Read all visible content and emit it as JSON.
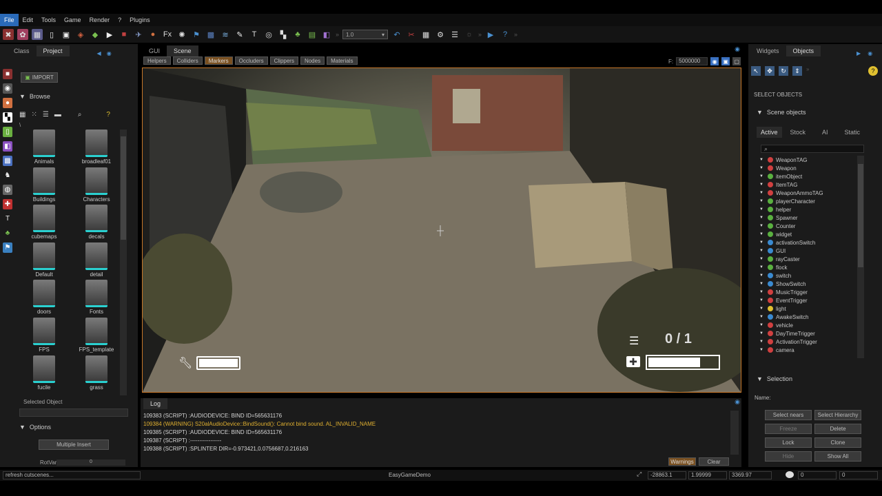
{
  "menu": [
    "File",
    "Edit",
    "Tools",
    "Game",
    "Render",
    "?",
    "Plugins"
  ],
  "toolbar": {
    "combo_value": "1.0"
  },
  "left_panel": {
    "tabs": [
      "Class",
      "Project"
    ],
    "import_label": "IMPORT",
    "browse_label": "Browse",
    "path": "\\",
    "folders": [
      {
        "name": "Animals"
      },
      {
        "name": "broadleaf01"
      },
      {
        "name": "Buildings"
      },
      {
        "name": "Characters"
      },
      {
        "name": "cubemaps"
      },
      {
        "name": "decals"
      },
      {
        "name": "Default"
      },
      {
        "name": "detail"
      },
      {
        "name": "doors"
      },
      {
        "name": "Fonts"
      },
      {
        "name": "FPS"
      },
      {
        "name": "FPS_template"
      },
      {
        "name": "fucile"
      },
      {
        "name": "grass"
      }
    ],
    "selected_object_label": "Selected Object",
    "options_label": "Options",
    "multiple_insert_label": "Multiple Insert",
    "rotvar_label": "RotVar",
    "rotvar_value": "0"
  },
  "center": {
    "tabs": [
      "GUI",
      "Scene"
    ],
    "filters": [
      "Helpers",
      "Colliders",
      "Markers",
      "Occluders",
      "Clippers",
      "Nodes",
      "Materials"
    ],
    "far_label": "F:",
    "far_value": "5000000",
    "hud": {
      "ammo": "0 / 1",
      "health_fill": 0.75,
      "tool_fill": 1.0
    }
  },
  "log": {
    "tab": "Log",
    "lines": [
      {
        "text": "109383 (SCRIPT) :AUDIODEVICE: BIND ID=565631176",
        "color": "#d8d8d8"
      },
      {
        "text": "109384 (WARNING) S20alAudioDevice::BindSound(): Cannot bind sound. AL_INVALID_NAME",
        "color": "#e0b030"
      },
      {
        "text": "109385 (SCRIPT) :AUDIODEVICE: BIND ID=565631176",
        "color": "#d8d8d8"
      },
      {
        "text": "109387 (SCRIPT) :-----------------",
        "color": "#d8d8d8"
      },
      {
        "text": "109388 (SCRIPT) :SPLINTER DIR=-0.973421,0.0756687,0.216163",
        "color": "#d8d8d8"
      }
    ],
    "warnings_label": "Warnings",
    "clear_label": "Clear"
  },
  "right_panel": {
    "tabs": [
      "Widgets",
      "Objects"
    ],
    "select_objects_label": "SELECT OBJECTS",
    "scene_objects_label": "Scene objects",
    "subtabs": [
      "Active",
      "Stock",
      "AI",
      "Static"
    ],
    "objects": [
      {
        "name": "WeaponTAG",
        "color": "#d04040"
      },
      {
        "name": "Weapon",
        "color": "#d04040"
      },
      {
        "name": "itemObject",
        "color": "#5ab040"
      },
      {
        "name": "ItemTAG",
        "color": "#d04040"
      },
      {
        "name": "WeaponAmmoTAG",
        "color": "#d04040"
      },
      {
        "name": "playerCharacter",
        "color": "#5ab040"
      },
      {
        "name": "helper",
        "color": "#5ab040"
      },
      {
        "name": "Spawner",
        "color": "#5ab040"
      },
      {
        "name": "Counter",
        "color": "#5ab040"
      },
      {
        "name": "widget",
        "color": "#5ab040"
      },
      {
        "name": "activationSwitch",
        "color": "#3a8ad0"
      },
      {
        "name": "GUI",
        "color": "#3a8ad0"
      },
      {
        "name": "rayCaster",
        "color": "#5ab040"
      },
      {
        "name": "flock",
        "color": "#5ab040"
      },
      {
        "name": "switch",
        "color": "#3a8ad0"
      },
      {
        "name": "ShowSwitch",
        "color": "#3a8ad0"
      },
      {
        "name": "MusicTrigger",
        "color": "#d04040"
      },
      {
        "name": "EventTrigger",
        "color": "#d04040"
      },
      {
        "name": "light",
        "color": "#e0c030"
      },
      {
        "name": "AwakeSwitch",
        "color": "#3a8ad0"
      },
      {
        "name": "vehicle",
        "color": "#d04040"
      },
      {
        "name": "DayTimeTrigger",
        "color": "#d04040"
      },
      {
        "name": "ActivationTrigger",
        "color": "#d04040"
      },
      {
        "name": "camera",
        "color": "#d04040"
      }
    ],
    "selection_label": "Selection",
    "name_label": "Name:",
    "buttons": [
      "Select nears",
      "Select Hierarchy",
      "Freeze",
      "Delete",
      "Lock",
      "Clone",
      "Hide",
      "Show All"
    ]
  },
  "status": {
    "message": "refresh cutscenes...",
    "title": "EasyGameDemo",
    "x": "-28863.1",
    "y": "1.99999",
    "z": "3369.97",
    "f1": "0",
    "f2": "0"
  }
}
